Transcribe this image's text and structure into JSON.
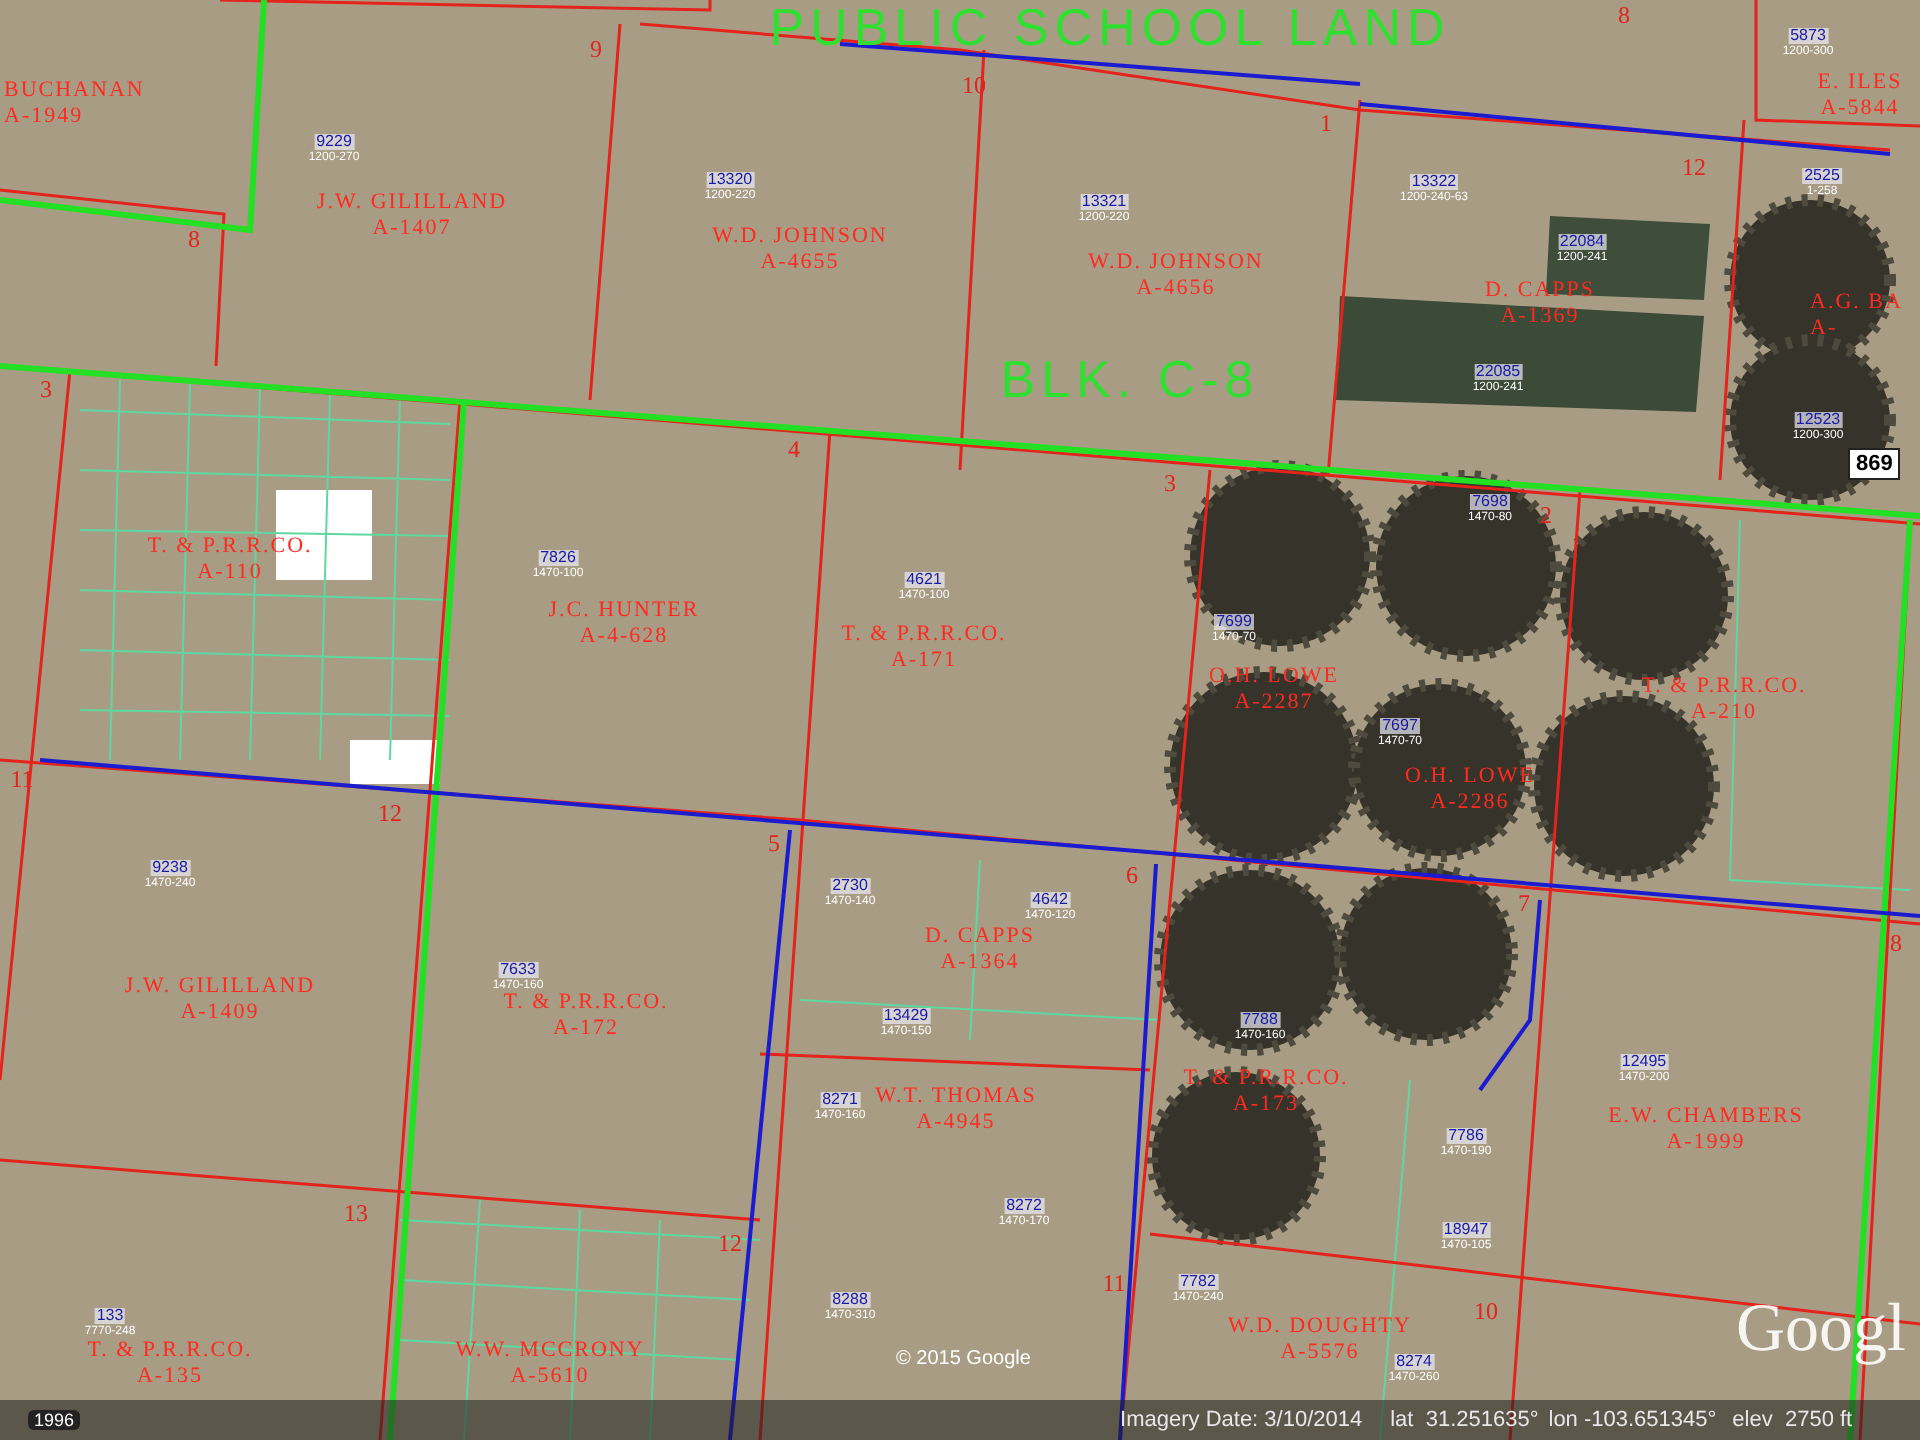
{
  "map": {
    "block_labels": [
      "PUBLIC SCHOOL LAND",
      "BLK. C-8"
    ],
    "owner_labels": [
      {
        "name": "BUCHANAN",
        "abstract": "A-1949"
      },
      {
        "name": "J.W. GILILLAND",
        "abstract": "A-1407"
      },
      {
        "name": "W.D. JOHNSON",
        "abstract": "A-4655"
      },
      {
        "name": "W.D. JOHNSON",
        "abstract": "A-4656"
      },
      {
        "name": "D. CAPPS",
        "abstract": "A-1369"
      },
      {
        "name": "E. ILES",
        "abstract": "A-5844"
      },
      {
        "name": "A.G. BA",
        "abstract": "A-"
      },
      {
        "name": "T. & P.R.R.CO.",
        "abstract": "A-110"
      },
      {
        "name": "J.C. HUNTER",
        "abstract": "A-4-628"
      },
      {
        "name": "T. & P.R.R.CO.",
        "abstract": "A-171"
      },
      {
        "name": "O.H. LOWE",
        "abstract": "A-2287"
      },
      {
        "name": "O.H. LOWE",
        "abstract": "A-2286"
      },
      {
        "name": "T. & P.R.R.CO.",
        "abstract": "A-210"
      },
      {
        "name": "J.W. GILILLAND",
        "abstract": "A-1409"
      },
      {
        "name": "T. & P.R.R.CO.",
        "abstract": "A-172"
      },
      {
        "name": "D. CAPPS",
        "abstract": "A-1364"
      },
      {
        "name": "W.T. THOMAS",
        "abstract": "A-4945"
      },
      {
        "name": "T. & P.R.R.CO.",
        "abstract": "A-173"
      },
      {
        "name": "E.W. CHAMBERS",
        "abstract": "A-1999"
      },
      {
        "name": "T. & P.R.R.CO.",
        "abstract": "A-135"
      },
      {
        "name": "W.W. MCCRONY",
        "abstract": "A-5610"
      },
      {
        "name": "W.D. DOUGHTY",
        "abstract": "A-5576"
      }
    ],
    "section_numbers": [
      "9",
      "10",
      "1",
      "12",
      "8",
      "8",
      "3",
      "4",
      "3",
      "2",
      "11",
      "12",
      "5",
      "6",
      "7",
      "8",
      "13",
      "12",
      "11",
      "10"
    ],
    "survey_labels": [
      {
        "number": "9229",
        "code": "1200-270"
      },
      {
        "number": "13320",
        "code": "1200-220"
      },
      {
        "number": "13321",
        "code": "1200-220"
      },
      {
        "number": "13322",
        "code": "1200-240-63"
      },
      {
        "number": "22084",
        "code": "1200-241"
      },
      {
        "number": "22085",
        "code": "1200-241"
      },
      {
        "number": "5873",
        "code": "1200-300"
      },
      {
        "number": "2525",
        "code": "1-258"
      },
      {
        "number": "12523",
        "code": "1200-300"
      },
      {
        "number": "7826",
        "code": "1470-100"
      },
      {
        "number": "4621",
        "code": "1470-100"
      },
      {
        "number": "7699",
        "code": "1470-70"
      },
      {
        "number": "7698",
        "code": "1470-80"
      },
      {
        "number": "7697",
        "code": "1470-70"
      },
      {
        "number": "9238",
        "code": "1470-240"
      },
      {
        "number": "7633",
        "code": "1470-160"
      },
      {
        "number": "2730",
        "code": "1470-140"
      },
      {
        "number": "4642",
        "code": "1470-120"
      },
      {
        "number": "13429",
        "code": "1470-150"
      },
      {
        "number": "8271",
        "code": "1470-160"
      },
      {
        "number": "7788",
        "code": "1470-160"
      },
      {
        "number": "7786",
        "code": "1470-190"
      },
      {
        "number": "18947",
        "code": "1470-105"
      },
      {
        "number": "12495",
        "code": "1470-200"
      },
      {
        "number": "8288",
        "code": "1470-310"
      },
      {
        "number": "133",
        "code": "7770-248"
      },
      {
        "number": "8272",
        "code": "1470-170"
      },
      {
        "number": "8274",
        "code": "1470-260"
      },
      {
        "number": "7782",
        "code": "1470-240"
      }
    ],
    "road_shield": "869"
  },
  "status_bar": {
    "year": "1996",
    "copyright": "© 2015 Google",
    "imagery_date": "Imagery Date: 3/10/2014",
    "lat": "lat  31.251635°",
    "lon": "lon -103.651345°",
    "elev": "elev  2750 ft"
  },
  "logo": "Googl"
}
